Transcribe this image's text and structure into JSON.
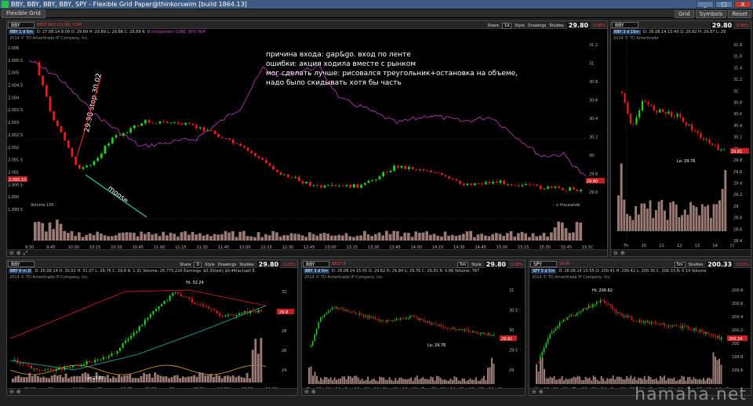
{
  "window": {
    "title": "BBY, BBY, BBY, BBY, SPY - Flexible Grid Paper@thinkorswim [build 1864.13]",
    "buttons": [
      "_",
      "□",
      "X"
    ]
  },
  "toolbar": {
    "grid_tab": "Flexible Grid",
    "right_buttons": [
      "Grid",
      "Symbols",
      "Reset"
    ]
  },
  "panels": {
    "main": {
      "symbol": "BBY",
      "company": "BEST BUY CO INC COM",
      "timeframe": "1d",
      "last_price": "29.80",
      "change": "0.08%",
      "quote_tag": "BBY 1 d 5m",
      "quote_text": "D: 27.08.14 8:08  O: 29.89  H: 29.89  L: 29.88  C: 29.89  R: 0",
      "compare_text": "comparison (LINE, SPX)  N/A",
      "copyright": "2014 © TD Ameritrade IP Company, Inc.",
      "volume_label": "Volume",
      "volume_value": "100",
      "volume_unit": "x thousands",
      "ylabels": [
        "2,006",
        "2,005.5",
        "2,005",
        "2,004.5",
        "2,004",
        "2,003.5",
        "2,003",
        "2,002.5",
        "2,002",
        "2,001.5",
        "2,001",
        "2,000.5",
        "2,000",
        "1,999.5"
      ],
      "ylabels_right": [
        "31.2",
        "31",
        "30.8",
        "30.6",
        "30.4",
        "30.2",
        "30",
        "29.8",
        "29.6"
      ],
      "xlabels": [
        "9:30",
        "9:45",
        "10:00",
        "10:15",
        "10:30",
        "10:45",
        "11:00",
        "11:15",
        "11:30",
        "11:45",
        "12:00",
        "12:15",
        "12:30",
        "12:45",
        "13:00",
        "13:15",
        "13:30",
        "13:45",
        "14:00",
        "14:15",
        "14:30",
        "14:45",
        "15:00",
        "15:15",
        "15:30",
        "15:45",
        "15:5C"
      ],
      "spx_tag": "2,000.33",
      "price_tag": "29.80",
      "annotations": {
        "line1": "причина входа: gap&go. вход по ленте",
        "line2": "ошибки: акция ходила вместе с рынком",
        "line3": "мог сделать лучше: рисовался треугольник+остановка на объеме,",
        "line4": " надо было скидывать хотя бы часть",
        "stop": "29.98 stop 30.02",
        "moose": "moose"
      }
    },
    "right_top": {
      "symbol": "BBY",
      "company": "BEST BUY CO I",
      "last_price": "29.80",
      "change": "0.08%",
      "quote_tag": "BBY 3 d 15m",
      "quote_text": "D: 26.08.14 15:45  O: 29.82  H: 29.87  L: 29",
      "copyright": "2014 © TD Ameritrade",
      "ylabels": [
        "31.8",
        "31.6",
        "31.4",
        "31.2",
        "31",
        "30.8",
        "30.6",
        "30.4",
        "30.2",
        "30",
        "29.8",
        "29.6",
        "29.4",
        "29.2",
        "29",
        "28.8",
        "28.6",
        "28.4"
      ],
      "xlabels": [
        "Th",
        "10",
        "11",
        "12",
        "13",
        "14",
        "Cl"
      ],
      "low_label": "Lo: 29.76",
      "price_tag": "29.81"
    },
    "bottom_left": {
      "symbol": "BBY",
      "timeframe": "D",
      "last_price": "29.80",
      "change": "0.08%",
      "quote_tag": "BBY 6 m D",
      "quote_text": "D: 26.08.14  O: 30.52  H: 31.07  L: 29.76  C: 29.8  R: 1.31  Volume: 26,775,220  Earnings: $0.30(est) $0.44(actual)  E",
      "copyright": "2014 © TD Ameritrade IP Company, Inc.",
      "ylabels": [
        "32",
        "30",
        "28",
        "26",
        "24"
      ],
      "xlabels": [
        "01:03",
        "03",
        "14:04",
        "15",
        "12:05",
        "02:06",
        "06",
        "30:06",
        "14:07",
        "08:08",
        "11:09"
      ],
      "hi_label": "Hi: 32.24",
      "lo_label": "Lo: 23.87",
      "price_tag": "29.8"
    },
    "bottom_mid": {
      "symbol": "BBY",
      "company": "BEST B",
      "timeframe": "5m",
      "last_price": "29.80",
      "change": "0.08%",
      "quote_tag": "BBY 3 d 5m",
      "quote_text": "D: 26.08.14 15:55  O: 29.82  H: 29.84  L: 29.76  C: 29.81  R: 0.06  Volume: 787",
      "copyright": "2014 © TD Ameritrade IP Company, Inc.",
      "ylabels": [
        "31",
        "30.5",
        "30",
        "29.5",
        "29"
      ],
      "xlabels": [
        "Th",
        "10",
        "12",
        "14",
        "Fr",
        "10",
        "12",
        "14",
        "Mo",
        "10",
        "12",
        "14",
        "Tu",
        "10",
        "12",
        "14",
        "We",
        "10",
        "12",
        "14",
        "Cl"
      ],
      "low_label": "Lo: 29.76",
      "price_tag": "29.81"
    },
    "bottom_right": {
      "symbol": "SPY",
      "company": "SPDR",
      "timeframe": "5m",
      "last_price": "200.33",
      "change": "0.03%",
      "quote_tag": "SPY 5 d 5m",
      "quote_text": "D: 26.08.14 15:55  O: 200.41  H: 200.42  L: 200.30  C: 200.33  R: 0.14  Volume",
      "copyright": "2014 © TD Ameritrade IP Company, Inc.",
      "ylabels": [
        "200.8",
        "200.6",
        "200.4",
        "200.2",
        "200",
        "199.8",
        "199.6"
      ],
      "xlabels": [
        "We",
        "10",
        "12",
        "14",
        "Th",
        "10",
        "12",
        "14",
        "Fr",
        "10",
        "12",
        "14",
        "Mo",
        "10",
        "12",
        "14",
        "Tu",
        "10",
        "12",
        "14",
        "Cl"
      ],
      "hi_label": "Hi: 200.82",
      "price_tag": "200.34"
    }
  },
  "header_buttons": {
    "share": "Share",
    "style": "Style",
    "drawings": "Drawings",
    "studies": "Studies"
  },
  "watermark": "hamaha.net"
}
